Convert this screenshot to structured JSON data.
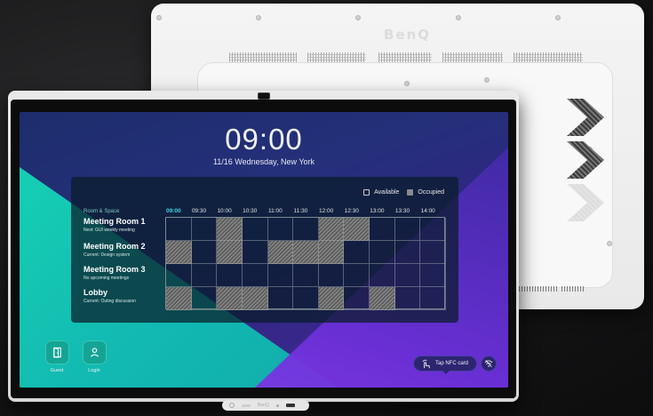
{
  "rear_device": {
    "brand": "BenQ"
  },
  "front_device": {
    "clock": "09:00",
    "date_location": "11/16 Wednesday, New York",
    "legend": {
      "available": "Available",
      "occupied": "Occupied"
    },
    "rooms_header": "Room & Space",
    "time_slots": [
      "09:00",
      "09:30",
      "10:00",
      "10:30",
      "11:00",
      "11:30",
      "12:00",
      "12:30",
      "13:00",
      "13:30",
      "14:00"
    ],
    "current_slot_index": 0,
    "rooms": [
      {
        "name": "Meeting Room 1",
        "status": "Next: GUI weekly meeting",
        "schedule": [
          0,
          0,
          1,
          0,
          0,
          0,
          1,
          1,
          0,
          0,
          0
        ]
      },
      {
        "name": "Meeting Room 2",
        "status": "Current: Design system",
        "schedule": [
          1,
          0,
          1,
          0,
          1,
          1,
          1,
          0,
          0,
          0,
          0
        ]
      },
      {
        "name": "Meeting Room 3",
        "status": "No upcoming meetings",
        "schedule": [
          0,
          0,
          0,
          0,
          0,
          0,
          0,
          0,
          0,
          0,
          0
        ]
      },
      {
        "name": "Lobby",
        "status": "Current: Outing discussion",
        "schedule": [
          1,
          0,
          1,
          1,
          0,
          0,
          1,
          0,
          1,
          0,
          0
        ]
      }
    ],
    "buttons": {
      "guest": "Guest",
      "login": "Login"
    },
    "nfc_label": "Tap NFC card",
    "bottom_bar_brand": "BenQ",
    "colors": {
      "teal": "#17d3b4",
      "navy": "#1d2d6c",
      "purple": "#6a2fd6",
      "accent_time": "#3fd4e6"
    },
    "icons": [
      "door-icon",
      "user-icon",
      "nfc-hand-icon",
      "wifi-off-icon"
    ]
  }
}
